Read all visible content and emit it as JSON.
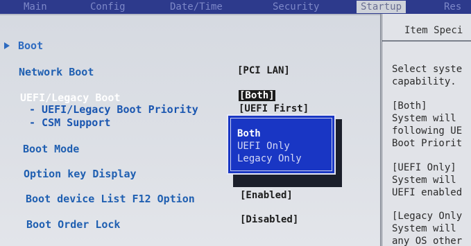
{
  "tabs": [
    {
      "label": "Main"
    },
    {
      "label": "Config"
    },
    {
      "label": "Date/Time"
    },
    {
      "label": "Security"
    },
    {
      "label": "Startup"
    },
    {
      "label": "Res"
    }
  ],
  "menu": {
    "boot_label": "Boot",
    "items": [
      {
        "label": "Network Boot",
        "value": "[PCI LAN]"
      },
      {
        "label": "UEFI/Legacy Boot",
        "value": "[Both]"
      },
      {
        "label": "- UEFI/Legacy Boot Priority",
        "value": "[UEFI First]"
      },
      {
        "label": "- CSM Support",
        "value": ""
      },
      {
        "label": "Boot Mode",
        "value": ""
      },
      {
        "label": "Option key Display",
        "value": ""
      },
      {
        "label": "Boot device List F12 Option",
        "value": "[Enabled]"
      },
      {
        "label": "Boot Order Lock",
        "value": "[Disabled]"
      }
    ]
  },
  "popup": {
    "options": [
      "Both",
      "UEFI Only",
      "Legacy Only"
    ],
    "selected": "Both"
  },
  "help": {
    "title": "Item Speci",
    "lines": [
      "Select syste",
      "capability.",
      "",
      "[Both]",
      "System will",
      "following UE",
      "Boot Priorit",
      "",
      "[UEFI Only]",
      "System will",
      "UEFI enabled",
      "",
      "[Legacy Only",
      "System will",
      "any OS other"
    ]
  },
  "colors": {
    "topbar": "#2d3a8c",
    "label": "#1f5fb1",
    "popup": "#1936c4"
  }
}
